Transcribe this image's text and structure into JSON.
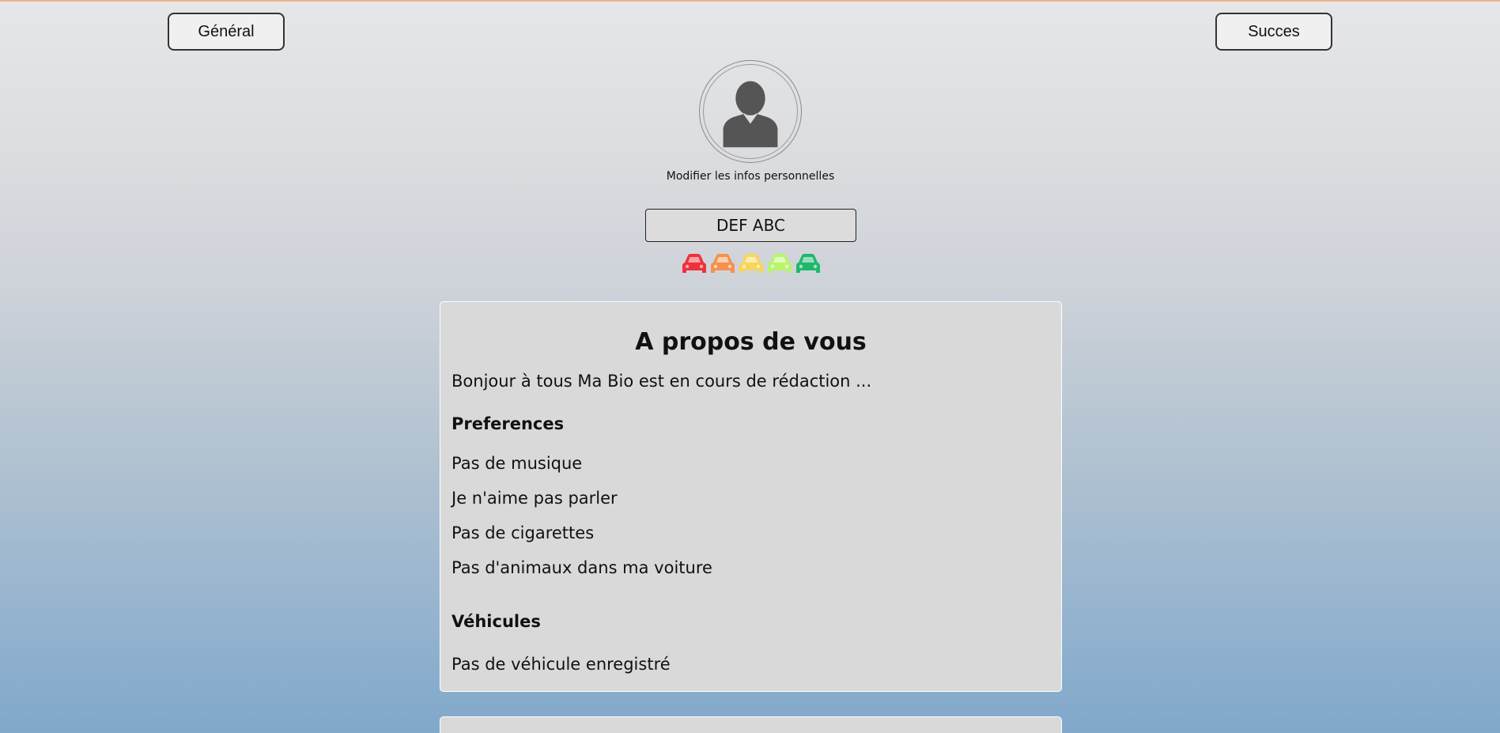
{
  "nav": {
    "general_label": "Général",
    "succes_label": "Succes"
  },
  "profile": {
    "avatar_icon": "user-silhouette-icon",
    "edit_link": "Modifier les infos personnelles",
    "name": "DEF ABC",
    "rating_icons": [
      {
        "icon": "car-icon",
        "color": "#f0303a"
      },
      {
        "icon": "car-icon",
        "color": "#f4914d"
      },
      {
        "icon": "car-icon",
        "color": "#f7d65a"
      },
      {
        "icon": "car-icon",
        "color": "#b8f56a"
      },
      {
        "icon": "car-icon",
        "color": "#1fb86b"
      }
    ]
  },
  "about": {
    "title": "A propos de vous",
    "bio": "Bonjour à tous Ma Bio est en cours de rédaction ...",
    "preferences_title": "Preferences",
    "preferences": [
      "Pas de musique",
      "Je n'aime pas parler",
      "Pas de cigarettes",
      "Pas d'animaux dans ma voiture"
    ],
    "vehicles_title": "Véhicules",
    "vehicles": [
      "Pas de véhicule enregistré"
    ]
  }
}
